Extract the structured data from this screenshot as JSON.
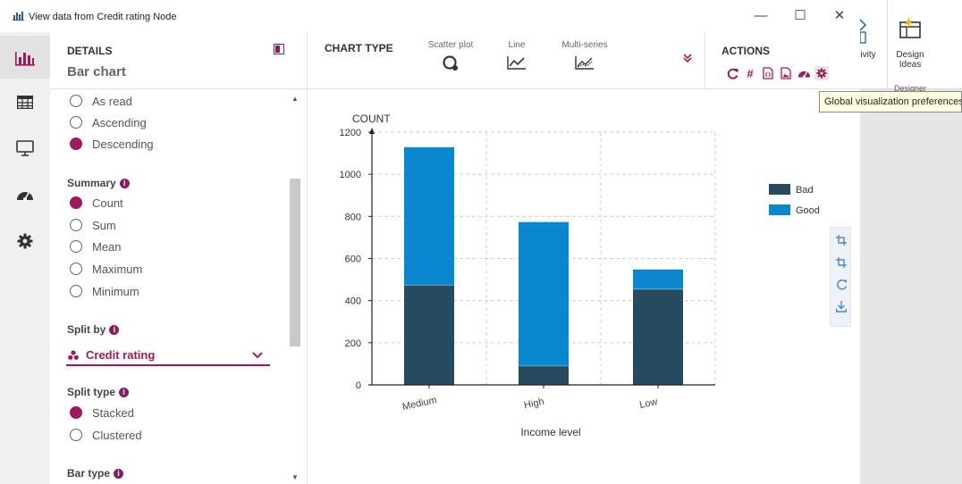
{
  "window": {
    "title": "View data from Credit rating Node",
    "controls": {
      "minimize": "—",
      "maximize": "☐",
      "close": "✕"
    }
  },
  "rail": {
    "items": [
      {
        "name": "bar-chart-icon",
        "active": true
      },
      {
        "name": "table-icon",
        "active": false
      },
      {
        "name": "monitor-icon",
        "active": false
      },
      {
        "name": "gauge-icon",
        "active": false
      },
      {
        "name": "gear-icon",
        "active": false
      }
    ]
  },
  "details": {
    "label": "DETAILS",
    "subtitle": "Bar chart",
    "sort_options": [
      {
        "label": "As read",
        "selected": false
      },
      {
        "label": "Ascending",
        "selected": false
      },
      {
        "label": "Descending",
        "selected": true
      }
    ],
    "summary": {
      "label": "Summary",
      "options": [
        {
          "label": "Count",
          "selected": true
        },
        {
          "label": "Sum",
          "selected": false
        },
        {
          "label": "Mean",
          "selected": false
        },
        {
          "label": "Maximum",
          "selected": false
        },
        {
          "label": "Minimum",
          "selected": false
        }
      ]
    },
    "split_by": {
      "label": "Split by",
      "value": "Credit rating"
    },
    "split_type": {
      "label": "Split type",
      "options": [
        {
          "label": "Stacked",
          "selected": true
        },
        {
          "label": "Clustered",
          "selected": false
        }
      ]
    },
    "bar_type": {
      "label": "Bar type"
    }
  },
  "toolbar": {
    "chart_type_label": "CHART TYPE",
    "chart_types": [
      {
        "label": "Scatter plot",
        "icon": "scatter-icon"
      },
      {
        "label": "Line",
        "icon": "line-chart-icon"
      },
      {
        "label": "Multi-series",
        "icon": "multi-series-icon"
      }
    ],
    "actions_label": "ACTIONS",
    "actions": [
      {
        "icon": "refresh-icon",
        "glyph": "C"
      },
      {
        "icon": "hash-icon",
        "glyph": "#"
      },
      {
        "icon": "code-file-icon",
        "glyph": ""
      },
      {
        "icon": "image-file-icon",
        "glyph": ""
      },
      {
        "icon": "gauge-icon",
        "glyph": ""
      },
      {
        "icon": "gear-icon",
        "glyph": ""
      }
    ]
  },
  "colors": {
    "accent": "#a0195f",
    "bad": "#264a5e",
    "good": "#0b87cf"
  },
  "chart_data": {
    "type": "bar",
    "stacked": true,
    "categories": [
      "Medium",
      "High",
      "Low"
    ],
    "series": [
      {
        "name": "Bad",
        "values": [
          475,
          90,
          455
        ]
      },
      {
        "name": "Good",
        "values": [
          655,
          685,
          95
        ]
      }
    ],
    "ylabel": "COUNT",
    "xlabel": "Income level",
    "ylim": [
      0,
      1200
    ],
    "yticks": [
      0,
      200,
      400,
      600,
      800,
      1000,
      1200
    ],
    "grid": true,
    "legend": "right"
  },
  "side_tools": [
    "crop-icon",
    "crop-alt-icon",
    "reset-icon",
    "download-icon"
  ],
  "background_app": {
    "partial_label": "ivity",
    "design_ideas": "Design Ideas",
    "designer": "Designer",
    "tooltip": "Global visualization preferences"
  }
}
